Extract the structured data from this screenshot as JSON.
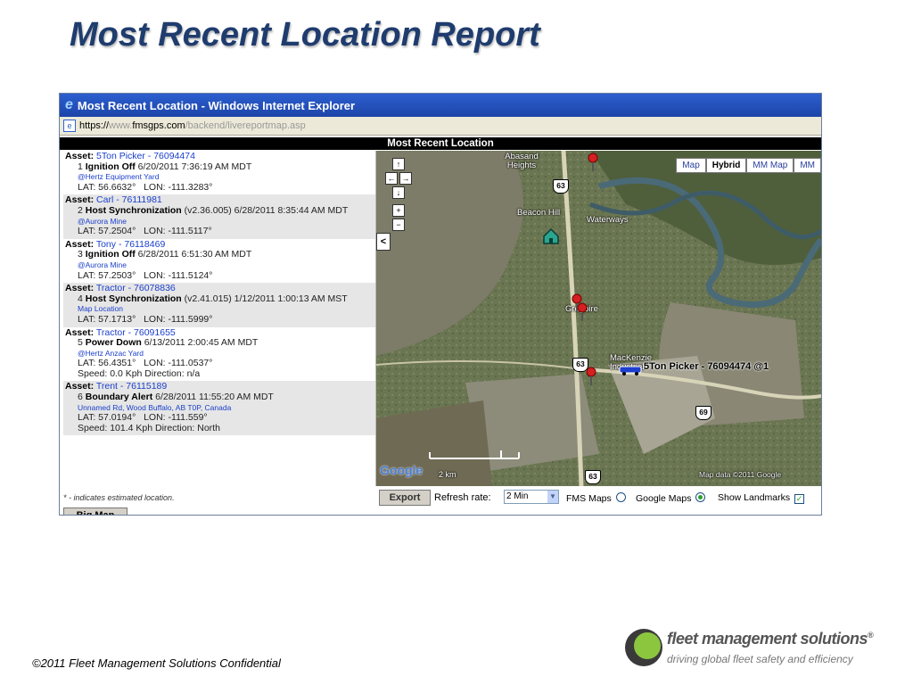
{
  "slide": {
    "title": "Most Recent Location Report",
    "copyright": "©2011 Fleet Management Solutions Confidential",
    "logo_name": "fleet management solutions",
    "logo_reg": "®",
    "logo_tagline": "driving global fleet safety and efficiency"
  },
  "window": {
    "title": "Most Recent Location - Windows Internet Explorer",
    "url_proto": "https://",
    "url_host": "www.",
    "url_domain": "fmsgps.com",
    "url_path": "/backend/livereportmap.asp"
  },
  "app": {
    "header": "Most Recent Location",
    "asset_label": "Asset:",
    "lat_label": "LAT:",
    "lon_label": "LON:",
    "entries": [
      {
        "asset": "5Ton Picker - 76094474",
        "num": "1",
        "event": "Ignition Off",
        "detail": "6/20/2011 7:36:19 AM MDT",
        "location": "@Hertz Equipment Yard",
        "lat": "56.6632°",
        "lon": "-111.3283°",
        "extra": ""
      },
      {
        "asset": "Carl - 76111981",
        "num": "2",
        "event": "Host Synchronization",
        "detail": "(v2.36.005) 6/28/2011 8:35:44 AM MDT",
        "location": "@Aurora Mine",
        "lat": "57.2504°",
        "lon": "-111.5117°",
        "extra": ""
      },
      {
        "asset": "Tony - 76118469",
        "num": "3",
        "event": "Ignition Off",
        "detail": "6/28/2011 6:51:30 AM MDT",
        "location": "@Aurora Mine",
        "lat": "57.2503°",
        "lon": "-111.5124°",
        "extra": ""
      },
      {
        "asset": "Tractor - 76078836",
        "num": "4",
        "event": "Host Synchronization",
        "detail": "(v2.41.015) 1/12/2011 1:00:13 AM MST",
        "location": "Map Location",
        "lat": "57.1713°",
        "lon": "-111.5999°",
        "extra": ""
      },
      {
        "asset": "Tractor - 76091655",
        "num": "5",
        "event": "Power Down",
        "detail": "6/13/2011 2:00:45 AM MDT",
        "location": "@Hertz Anzac Yard",
        "lat": "56.4351°",
        "lon": "-111.0537°",
        "extra": "Speed: 0.0 Kph   Direction: n/a"
      },
      {
        "asset": "Trent - 76115189",
        "num": "6",
        "event": "Boundary Alert",
        "detail": "6/28/2011 11:55:20 AM MDT",
        "location": "Unnamed Rd, Wood Buffalo, AB T0P, Canada",
        "lat": "57.0194°",
        "lon": "-111.559°",
        "extra": "Speed: 101.4 Kph   Direction: North"
      }
    ]
  },
  "map": {
    "types": [
      "Map",
      "Hybrid",
      "MM Map",
      "MM"
    ],
    "active_type": "Hybrid",
    "labels": {
      "abasand": "Abasand Heights",
      "beacon_hill": "Beacon Hill",
      "waterways": "Waterways",
      "gregoire": "Gregoire",
      "mackenzie": "MacKenzie Industrial",
      "vehicle": "5Ton Picker - 76094474 @1",
      "scale": "2 km",
      "attribution": "Map data ©2011 Google"
    },
    "shields": [
      "63",
      "63",
      "69",
      "63"
    ],
    "google": "Google"
  },
  "controls": {
    "note": "* - indicates estimated location.",
    "export": "Export",
    "refresh_label": "Refresh rate:",
    "refresh_value": "2 Min",
    "fms_maps": "FMS Maps",
    "google_maps": "Google Maps",
    "show_landmarks": "Show Landmarks",
    "big_map": "Big Map",
    "selected_map_source": "Google Maps",
    "landmarks_checked": true
  }
}
